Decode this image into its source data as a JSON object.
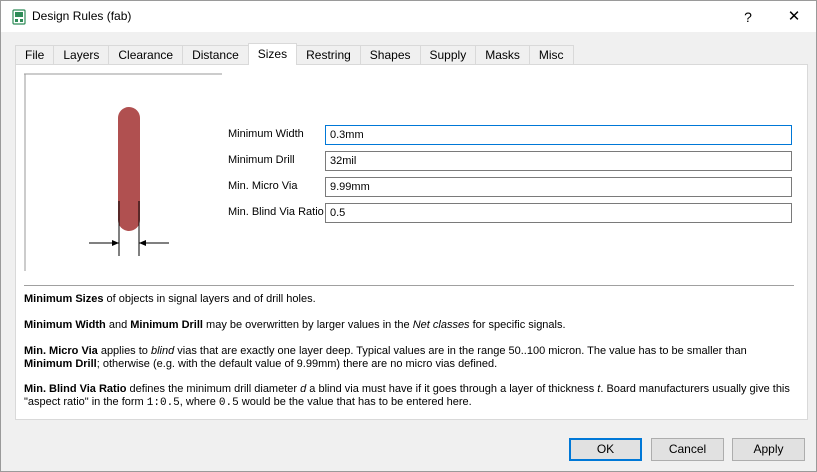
{
  "window": {
    "title": "Design Rules (fab)",
    "help_label": "?",
    "close_label": "✕"
  },
  "tabs": [
    {
      "label": "File"
    },
    {
      "label": "Layers"
    },
    {
      "label": "Clearance"
    },
    {
      "label": "Distance"
    },
    {
      "label": "Sizes",
      "active": true
    },
    {
      "label": "Restring"
    },
    {
      "label": "Shapes"
    },
    {
      "label": "Supply"
    },
    {
      "label": "Masks"
    },
    {
      "label": "Misc"
    }
  ],
  "form": {
    "min_width": {
      "label": "Minimum Width",
      "value": "0.3mm"
    },
    "min_drill": {
      "label": "Minimum Drill",
      "value": "32mil"
    },
    "min_micro_via": {
      "label": "Min. Micro Via",
      "value": "9.99mm"
    },
    "min_blind_via_ratio": {
      "label": "Min. Blind Via Ratio",
      "value": "0.5"
    }
  },
  "help": {
    "p1_b1": "Minimum Sizes",
    "p1_t1": " of objects in signal layers and of drill holes.",
    "p2_b1": "Minimum Width",
    "p2_t1": " and ",
    "p2_b2": "Minimum Drill",
    "p2_t2": " may be overwritten by larger values in the ",
    "p2_i1": "Net classes",
    "p2_t3": " for specific signals.",
    "p3_b1": "Min. Micro Via",
    "p3_t1": " applies to ",
    "p3_i1": "blind",
    "p3_t2": " vias that are exactly one layer deep. Typical values are in the range 50..100 micron. The value has to be smaller than ",
    "p3_b2": "Minimum Drill",
    "p3_t3": "; otherwise (e.g. with the default value of 9.99mm) there are no micro vias defined.",
    "p4_b1": "Min. Blind Via Ratio",
    "p4_t1": " defines the minimum drill diameter ",
    "p4_i1": "d",
    "p4_t2": " a blind via must have if it goes through a layer of thickness ",
    "p4_i2": "t",
    "p4_t3": ". Board manufacturers usually give this \"aspect ratio\" in the form ",
    "p4_m1": "1:0.5",
    "p4_t4": ", where ",
    "p4_m2": "0.5",
    "p4_t5": " would be the value that has to be entered here."
  },
  "buttons": {
    "ok": "OK",
    "cancel": "Cancel",
    "apply": "Apply"
  },
  "colors": {
    "trace": "#b05050",
    "focus": "#0078d7"
  }
}
